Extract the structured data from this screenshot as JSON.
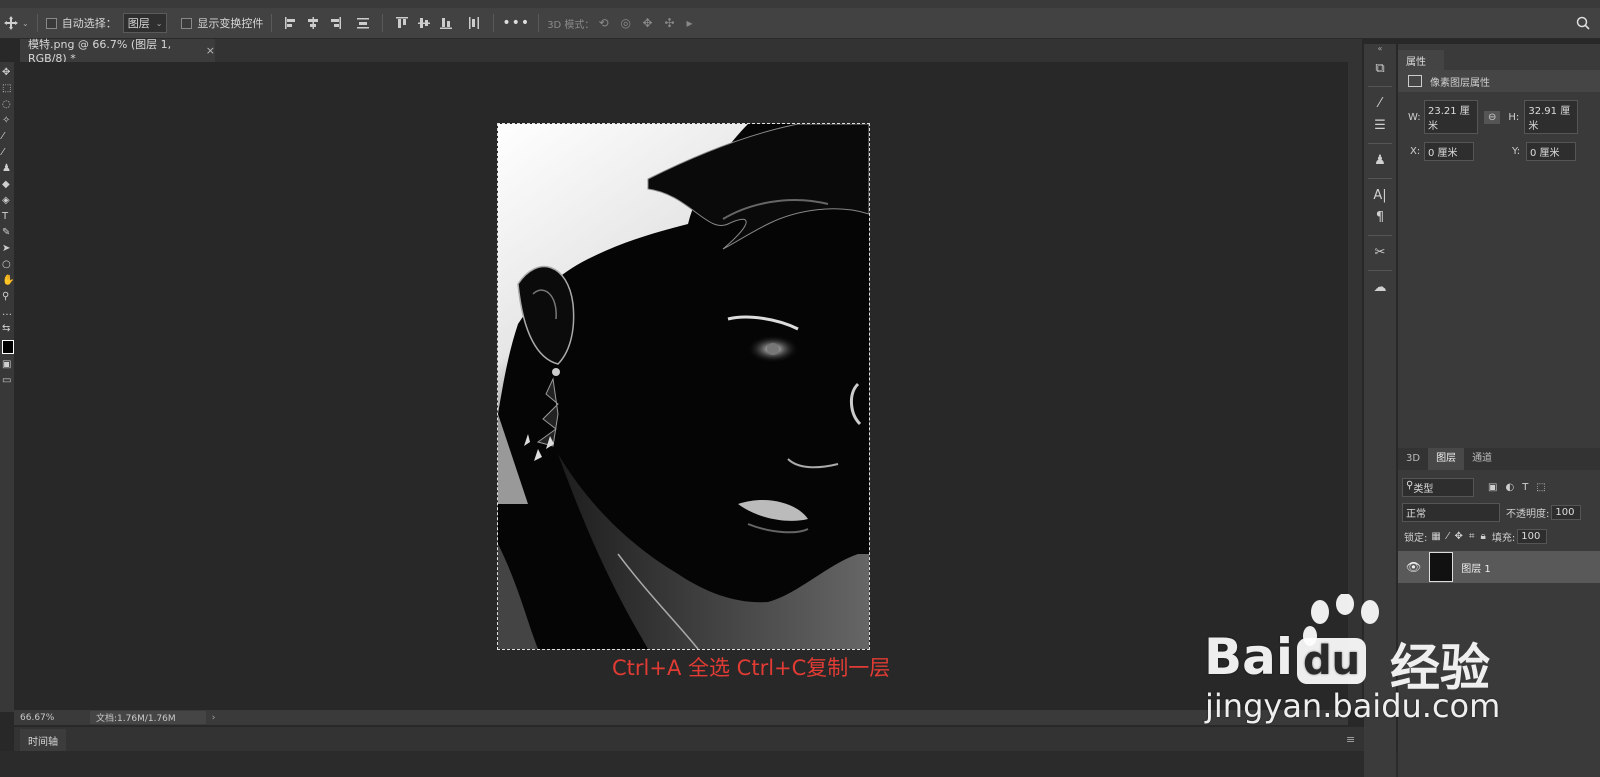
{
  "options_bar": {
    "auto_select_label": "自动选择：",
    "auto_select_value": "图层",
    "show_transform_label": "显示变换控件",
    "mode_3d_label": "3D 模式："
  },
  "document_tab": {
    "title": "模特.png @ 66.7% (图层 1, RGB/8) *",
    "close": "×"
  },
  "status_bar": {
    "zoom": "66.67%",
    "doc_info": "文档:1.76M/1.76M",
    "arrow": "›"
  },
  "timeline": {
    "tab_label": "时间轴"
  },
  "caption": "Ctrl+A 全选 Ctrl+C复制一层",
  "properties_panel": {
    "tab_label": "属性",
    "subtitle": "像素图层属性",
    "w_label": "W:",
    "w_value": "23.21 厘米",
    "h_label": "H:",
    "h_value": "32.91 厘米",
    "x_label": "X:",
    "x_value": "0 厘米",
    "y_label": "Y:",
    "y_value": "0 厘米"
  },
  "layers_panel": {
    "tabs": [
      "3D",
      "图层",
      "通道"
    ],
    "active_tab": "图层",
    "filter_kind": "类型",
    "blend_mode": "正常",
    "opacity_label": "不透明度:",
    "opacity_value": "100",
    "lock_label": "锁定:",
    "fill_label": "填充:",
    "fill_value": "100",
    "layer_name": "图层 1"
  },
  "watermark": {
    "brand": "Bai",
    "brand_du": "du",
    "product": "经验",
    "url": "jingyan.baidu.com"
  },
  "colors": {
    "caption": "#e13b34",
    "panel_bg": "#3a3a3a",
    "canvas_bg": "#282828"
  }
}
